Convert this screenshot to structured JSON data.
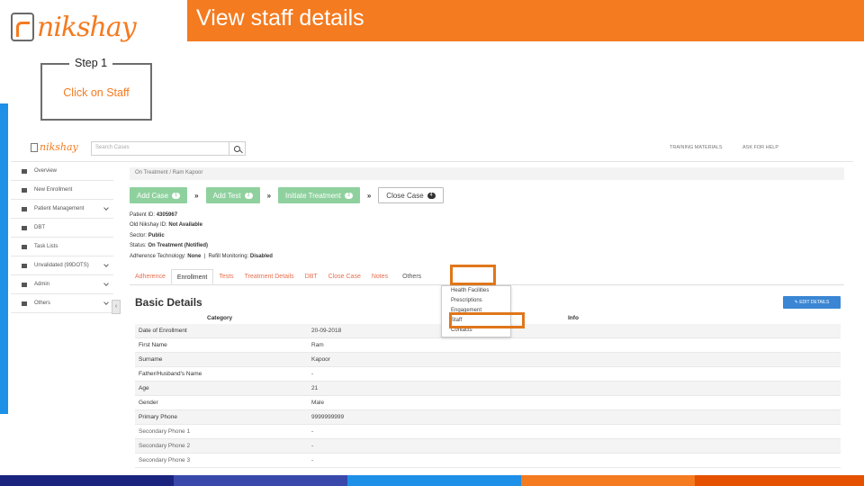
{
  "slide": {
    "logo_text": "nikshay",
    "title": "View staff details",
    "step_label": "Step 1",
    "step_text": "Click on Staff",
    "colors": {
      "accent": "#f47b20",
      "strip": "#1e90e8",
      "highlight": "#e0761a"
    }
  },
  "app": {
    "logo_text": "nikshay",
    "search_placeholder": "Search Cases",
    "top_links": [
      "TRAINING MATERIALS",
      "ASK FOR HELP"
    ],
    "sidebar": [
      {
        "label": "Overview",
        "chevron": false
      },
      {
        "label": "New Enrollment",
        "chevron": false
      },
      {
        "label": "Patient Management",
        "chevron": true
      },
      {
        "label": "DBT",
        "chevron": false
      },
      {
        "label": "Task Lists",
        "chevron": false
      },
      {
        "label": "Unvalidated (99DOTS)",
        "chevron": true
      },
      {
        "label": "Admin",
        "chevron": true
      },
      {
        "label": "Others",
        "chevron": true
      }
    ],
    "collapse_glyph": "‹",
    "breadcrumb": "On Treatment  /  Ram Kapoor",
    "actions": [
      {
        "label": "Add Case",
        "count": "1"
      },
      {
        "label": "Add Test",
        "count": "2"
      },
      {
        "label": "Initiate Treatment",
        "count": "3"
      },
      {
        "label": "Close Case",
        "count": "4"
      }
    ],
    "arrow_glyph": "»",
    "patient": {
      "id_label": "Patient ID:",
      "id_value": "4305967",
      "old_id_label": "Old Nikshay ID:",
      "old_id_value": "Not Available",
      "sector_label": "Sector:",
      "sector_value": "Public",
      "status_label": "Status:",
      "status_value": "On Treatment (Notified)",
      "adherence_label": "Adherence Technology:",
      "adherence_value": "None",
      "refill_label": "Refill Monitoring:",
      "refill_value": "Disabled"
    },
    "tabs": [
      "Adherence",
      "Enrollment",
      "Tests",
      "Treatment Details",
      "DBT",
      "Close Case",
      "Notes",
      "Others"
    ],
    "others_menu": [
      "Health Facilities",
      "Prescriptions",
      "Engagement",
      "Staff",
      "Contacts"
    ],
    "section_title": "Basic Details",
    "edit_button": "EDIT DETAILS",
    "col_headers": [
      "Category",
      "Info"
    ],
    "details": [
      {
        "k": "Date of Enrollment",
        "v": "20-09-2018"
      },
      {
        "k": "First Name",
        "v": "Ram"
      },
      {
        "k": "Surname",
        "v": "Kapoor"
      },
      {
        "k": "Father/Husband's Name",
        "v": "-"
      },
      {
        "k": "Age",
        "v": "21"
      },
      {
        "k": "Gender",
        "v": "Male"
      },
      {
        "k": "Primary Phone",
        "v": "9999999999"
      },
      {
        "k": "Secondary Phone 1",
        "v": "-"
      },
      {
        "k": "Secondary Phone 2",
        "v": "-"
      },
      {
        "k": "Secondary Phone 3",
        "v": "-"
      }
    ]
  },
  "bottom_bar_colors": [
    "#1a237e",
    "#3949ab",
    "#1e90e8",
    "#f47b20",
    "#e65100"
  ]
}
